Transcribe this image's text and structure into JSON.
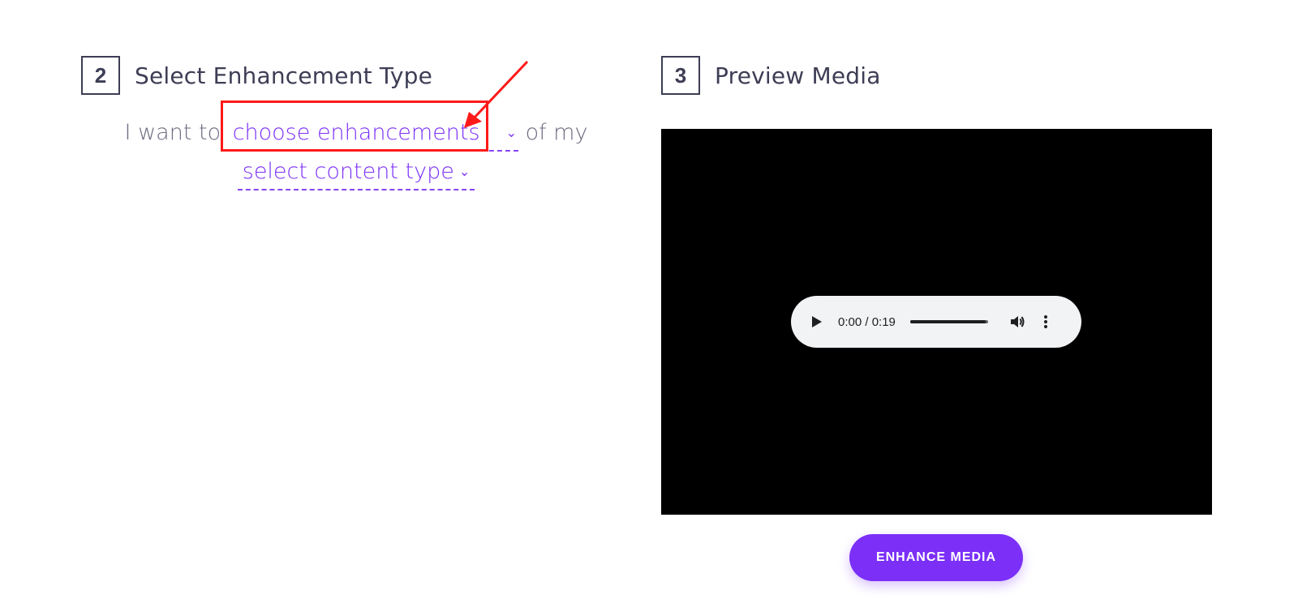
{
  "steps": {
    "step2": {
      "number": "2",
      "title": "Select Enhancement Type"
    },
    "step3": {
      "number": "3",
      "title": "Preview Media"
    }
  },
  "sentence": {
    "prefix": "I want to",
    "enhancement_dropdown": {
      "selected": "choose enhancements",
      "chevron": "chevron-down-icon"
    },
    "middle": "of my",
    "content_dropdown": {
      "selected": "select content type",
      "chevron": "chevron-down-icon"
    }
  },
  "player": {
    "time": "0:00 / 0:19",
    "progress": 0.97,
    "icons": {
      "play": "play-icon",
      "volume": "volume-icon",
      "menu": "more-vertical-icon"
    }
  },
  "actions": {
    "enhance_label": "ENHANCE MEDIA"
  },
  "colors": {
    "accent": "#7b2ff7",
    "text": "#3d3d55",
    "muted_text": "#6b6b80",
    "highlight": "#ff1a1a",
    "video_bg": "#000000",
    "player_bg": "#f1f3f4"
  }
}
